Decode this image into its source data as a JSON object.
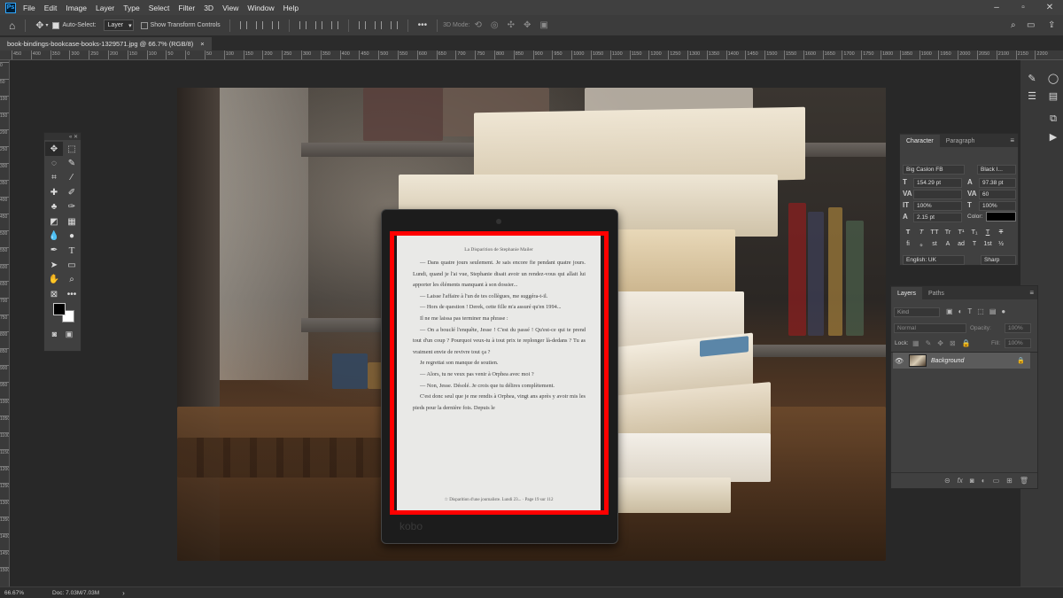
{
  "app": {
    "logo_text": "Ps",
    "menu": [
      "File",
      "Edit",
      "Image",
      "Layer",
      "Type",
      "Select",
      "Filter",
      "3D",
      "View",
      "Window",
      "Help"
    ]
  },
  "options_bar": {
    "auto_select_label": "Auto-Select:",
    "auto_select_target": "Layer",
    "show_transform_label": "Show Transform Controls",
    "mode_3d_label": "3D Mode:"
  },
  "document": {
    "tab_title": "book-bindings-bookcase-books-1329571.jpg @ 66.7% (RGB/8)",
    "close_glyph": "×"
  },
  "ruler": {
    "top_labels": [
      "450",
      "400",
      "350",
      "300",
      "250",
      "200",
      "150",
      "100",
      "50",
      "0",
      "50",
      "100",
      "150",
      "200",
      "250",
      "300",
      "350",
      "400",
      "450",
      "500",
      "550",
      "600",
      "650",
      "700",
      "750",
      "800",
      "850",
      "900",
      "950",
      "1000",
      "1050",
      "1100",
      "1150",
      "1200",
      "1250",
      "1300",
      "1350",
      "1400",
      "1450",
      "1500",
      "1550",
      "1600",
      "1650",
      "1700",
      "1750",
      "1800",
      "1850",
      "1900",
      "1950",
      "2000",
      "2050",
      "2100",
      "2150",
      "2200"
    ],
    "left_labels": [
      "0",
      "50",
      "100",
      "150",
      "200",
      "250",
      "300",
      "350",
      "400",
      "450",
      "500",
      "550",
      "600",
      "650",
      "700",
      "750",
      "800",
      "850",
      "900",
      "950",
      "1000",
      "1050",
      "1100",
      "1150",
      "1200",
      "1250",
      "1300",
      "1350",
      "1400",
      "1450",
      "1500"
    ]
  },
  "ereader": {
    "header": "La Disparition de Stephanie Mailer",
    "body": [
      "— Dans quatre jours seulement. Je sais encore fie pendant quatre jours. Lundi, quand je l'ai vue, Stephanie disait avoir un rendez-vous qui allait lui apporter les éléments manquant à son dossier...",
      "— Laisse l'affaire à l'un de tes collègues, me suggéra-t-il.",
      "— Hors de question ! Derek, cette fille m'a assuré qu'en 1994...",
      "Il ne me laissa pas terminer ma phrase :",
      "— On a bouclé l'enquête, Jesse ! C'est du passé ! Qu'est-ce qui te prend tout d'un coup ? Pourquoi veux-tu à tout prix te replonger là-dedans ? Tu as vraiment envie de revivre tout ça ?",
      "Je regrettai son manque de soutien.",
      "— Alors, tu ne veux pas venir à Orphea avec moi ?",
      "— Non, Jesse. Désolé. Je crois que tu délires complètement.",
      "C'est donc seul que je me rendis à Orphea, vingt ans après y avoir mis les pieds pour la dernière fois. Depuis le"
    ],
    "footer": "☆ Disparition d'une journaliste. Lundi 23...  ·  Page 19 sur 112",
    "brand": "kobo"
  },
  "character_panel": {
    "tabs": [
      "Character",
      "Paragraph"
    ],
    "font_family": "Big Caslon FB",
    "font_style": "Black I...",
    "font_size": "154.29 pt",
    "leading": "97.38 pt",
    "kerning": "",
    "tracking": "60",
    "vertical_scale": "100%",
    "horizontal_scale": "100%",
    "baseline_shift": "2.15 pt",
    "color_label": "Color:",
    "language": "English: UK",
    "anti_alias": "Sharp",
    "style_buttons": [
      "T",
      "T",
      "TT",
      "Tr",
      "T¹",
      "T₁",
      "T",
      "T"
    ],
    "extra_buttons": [
      "fi",
      "ℴ",
      "st",
      "A",
      "ad",
      "T",
      "1st",
      "½"
    ]
  },
  "layers_panel": {
    "tabs": [
      "Layers",
      "Paths"
    ],
    "filter_kind": "Kind",
    "blend_mode": "Normal",
    "opacity_label": "Opacity:",
    "opacity": "100%",
    "lock_label": "Lock:",
    "fill_label": "Fill:",
    "fill": "100%",
    "layers": [
      {
        "name": "Background",
        "visible": true,
        "locked": true
      }
    ]
  },
  "status": {
    "zoom": "66.67%",
    "doc_size": "Doc: 7.03M/7.03M",
    "arrow": "›"
  },
  "colors": {
    "accent_red": "#ff0000",
    "app_bg": "#282828",
    "panel_bg": "#404040"
  }
}
